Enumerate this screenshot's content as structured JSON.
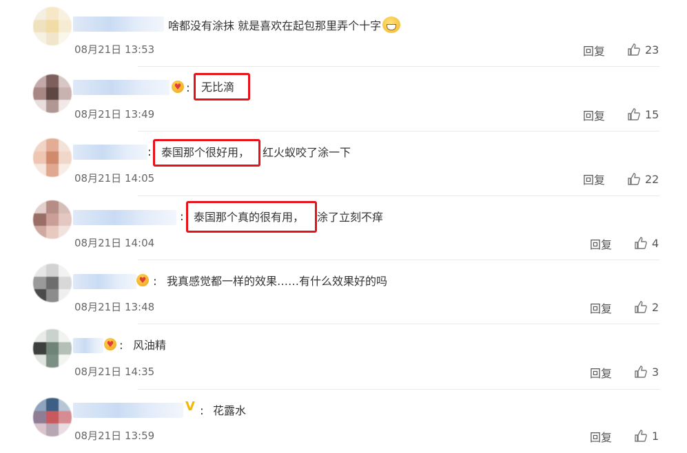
{
  "comments": [
    {
      "text": "啥都没有涂抹 就是喜欢在起包那里弄个十字",
      "emoji": "grin-emoji",
      "time": "08月21日 13:53",
      "reply": "回复",
      "likes": "23",
      "avatar_colors": [
        "#f5efe2",
        "#f6e7c7",
        "#f8f1df",
        "#efe2be",
        "#f2dca5",
        "#f6ecd3",
        "#f7f1e3",
        "#f1e6cc",
        "#fbf6ea"
      ]
    },
    {
      "highlight": "无比滴",
      "badge": "heart-eyes-badge",
      "time": "08月21日 13:49",
      "reply": "回复",
      "likes": "15",
      "avatar_colors": [
        "#c4a9ab",
        "#7d5f5c",
        "#d8c7c5",
        "#a88784",
        "#5e4743",
        "#c9b3b1",
        "#e8dedd",
        "#b09793",
        "#f0e9e8"
      ]
    },
    {
      "highlight": "泰国那个很好用，",
      "text": "红火蚁咬了涂一下",
      "time": "08月21日 14:05",
      "reply": "回复",
      "likes": "22",
      "avatar_colors": [
        "#f0d4c6",
        "#e3ad95",
        "#f4e1d8",
        "#efc6b2",
        "#d08a6d",
        "#f1d6ca",
        "#f6e6de",
        "#e0a88e",
        "#f8ece6"
      ]
    },
    {
      "highlight": "泰国那个真的很有用，",
      "text": "涂了立刻不痒",
      "time": "08月21日 14:04",
      "reply": "回复",
      "likes": "4",
      "avatar_colors": [
        "#e3cfcc",
        "#b68c86",
        "#d7bdb8",
        "#9b6d67",
        "#c99f98",
        "#e4c7c1",
        "#cfa89f",
        "#e8c9bf",
        "#f1e2de"
      ]
    },
    {
      "text": "我真感觉都一样的效果……有什么效果好的吗",
      "badge": "heart-eyes-badge",
      "time": "08月21日 13:48",
      "reply": "回复",
      "likes": "2",
      "avatar_colors": [
        "#e6e6e6",
        "#d2d2d2",
        "#f2f2f2",
        "#9a9a9a",
        "#6d6d6d",
        "#d8d8d8",
        "#4a4a4a",
        "#8c8c8c",
        "#efefef"
      ]
    },
    {
      "text": "风油精",
      "badge": "heart-eyes-badge",
      "time": "08月21日 14:35",
      "reply": "回复",
      "likes": "3",
      "avatar_colors": [
        "#e8ebe8",
        "#c9d2cc",
        "#f1f3f1",
        "#3c3f3d",
        "#6f8378",
        "#b3bfb7",
        "#dfe4e0",
        "#7c8f84",
        "#f3f5f3"
      ]
    },
    {
      "text": "花露水",
      "badge": "v-badge",
      "time": "08月21日 13:59",
      "reply": "回复",
      "likes": "1",
      "avatar_colors": [
        "#8ea4bc",
        "#3e5f84",
        "#b7c6d6",
        "#8e7d95",
        "#c85a5e",
        "#d78c91",
        "#d9c4cc",
        "#b7a6b3",
        "#e9dde3"
      ]
    }
  ]
}
